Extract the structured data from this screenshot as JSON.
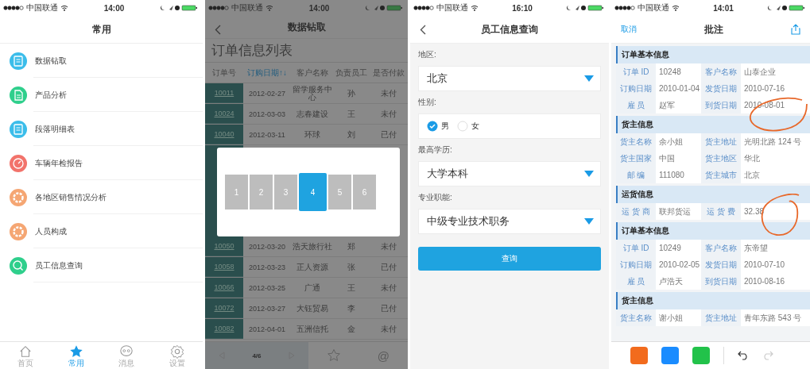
{
  "screens": [
    {
      "kind": "menu",
      "status": {
        "carrier": "中国联通",
        "time": "14:00"
      },
      "title": "常用",
      "items": [
        {
          "label": "数据钻取",
          "kind": "doc",
          "color": "#3bbdea"
        },
        {
          "label": "产品分析",
          "kind": "page",
          "color": "#2fcf8c"
        },
        {
          "label": "段落明细表",
          "kind": "doc",
          "color": "#3bbdea"
        },
        {
          "label": "车辆年检报告",
          "kind": "gauge",
          "color": "#f2736b"
        },
        {
          "label": "各地区销售情况分析",
          "kind": "ring",
          "color": "#f5a673"
        },
        {
          "label": "人员构成",
          "kind": "ring",
          "color": "#f5a673"
        },
        {
          "label": "员工信息查询",
          "kind": "search",
          "color": "#2fcf8c"
        }
      ],
      "tab_bar": [
        {
          "label": "首页",
          "kind": "home",
          "selected": false
        },
        {
          "label": "常用",
          "kind": "star",
          "selected": true
        },
        {
          "label": "消息",
          "kind": "chat",
          "selected": false
        },
        {
          "label": "设置",
          "kind": "gear",
          "selected": false
        }
      ]
    },
    {
      "kind": "table",
      "status": {
        "carrier": "中国联通",
        "time": "14:00"
      },
      "title": "数据钻取",
      "heading": "订单信息列表",
      "columns": [
        {
          "label": "订单号",
          "sorted": false
        },
        {
          "label": "订购日期↑↓",
          "sorted": true
        },
        {
          "label": "客户名称",
          "sorted": false
        },
        {
          "label": "负责员工",
          "sorted": false
        },
        {
          "label": "是否付款",
          "sorted": false
        }
      ],
      "rows_above": [
        [
          "10011",
          "2012-02-27",
          "留学服务中心",
          "孙",
          "未付"
        ],
        [
          "10024",
          "2012-03-03",
          "志春建设",
          "王",
          "未付"
        ],
        [
          "10040",
          "2012-03-11",
          "环球",
          "刘",
          "已付"
        ]
      ],
      "rows_below": [
        [
          "10050",
          "2012-03-20",
          "浩天旅行社",
          "郑",
          "未付"
        ],
        [
          "10058",
          "2012-03-23",
          "正人资源",
          "张",
          "已付"
        ],
        [
          "10066",
          "2012-03-25",
          "广通",
          "王",
          "未付"
        ],
        [
          "10072",
          "2012-03-27",
          "大钰贸易",
          "李",
          "已付"
        ],
        [
          "10082",
          "2012-04-01",
          "五洲信托",
          "金",
          "未付"
        ]
      ],
      "pager": [
        {
          "label": "1",
          "selected": false
        },
        {
          "label": "2",
          "selected": false
        },
        {
          "label": "3",
          "selected": false
        },
        {
          "label": "4",
          "selected": true
        },
        {
          "label": "5",
          "selected": false
        },
        {
          "label": "6",
          "selected": false
        }
      ],
      "page_indicator": "4/6",
      "at_sign": "@"
    },
    {
      "kind": "form",
      "status": {
        "carrier": "中国联通",
        "time": "16:10"
      },
      "title": "员工信息查询",
      "fields": [
        {
          "kind": "select",
          "label": "地区:",
          "value": "北京"
        },
        {
          "kind": "radio",
          "label": "性别:",
          "options": [
            {
              "label": "男",
              "selected": true
            },
            {
              "label": "女",
              "selected": false
            }
          ]
        },
        {
          "kind": "select",
          "label": "最高学历:",
          "value": "大学本科"
        },
        {
          "kind": "select",
          "label": "专业职能:",
          "value": "中级专业技术职务"
        }
      ],
      "button": "查询"
    },
    {
      "kind": "annotate",
      "status": {
        "carrier": "中国联通",
        "time": "14:01"
      },
      "title": "批注",
      "cancel": "取消",
      "sections": [
        {
          "title": "订单基本信息",
          "rows": [
            [
              "订单 ID",
              "10248",
              "客户名称",
              "山泰企业"
            ],
            [
              "订购日期",
              "2010-01-04",
              "发货日期",
              "2010-07-16"
            ],
            [
              "雇 员",
              "赵军",
              "到货日期",
              "2010-08-01"
            ]
          ]
        },
        {
          "title": "货主信息",
          "rows": [
            [
              "货主名称",
              "余小姐",
              "货主地址",
              "光明北路 124 号"
            ],
            [
              "货主国家",
              "中国",
              "货主地区",
              "华北"
            ],
            [
              "邮 编",
              "111080",
              "货主城市",
              "北京"
            ]
          ]
        },
        {
          "title": "运货信息",
          "rows": [
            [
              "运 货 商",
              "联邦货运",
              "运 货 费",
              "32.38"
            ]
          ]
        },
        {
          "title": "订单基本信息",
          "rows": [
            [
              "订单 ID",
              "10249",
              "客户名称",
              "东帝望"
            ],
            [
              "订购日期",
              "2010-02-05",
              "发货日期",
              "2010-07-10"
            ],
            [
              "雇 员",
              "卢浩天",
              "到货日期",
              "2010-08-16"
            ]
          ]
        },
        {
          "title": "货主信息",
          "rows": [
            [
              "货主名称",
              "谢小姐",
              "货主地址",
              "青年东路 543 号"
            ]
          ]
        }
      ],
      "pens": [
        {
          "color": "#f26b1d"
        },
        {
          "color": "#1a8cff"
        },
        {
          "color": "#22c24a"
        }
      ]
    }
  ]
}
